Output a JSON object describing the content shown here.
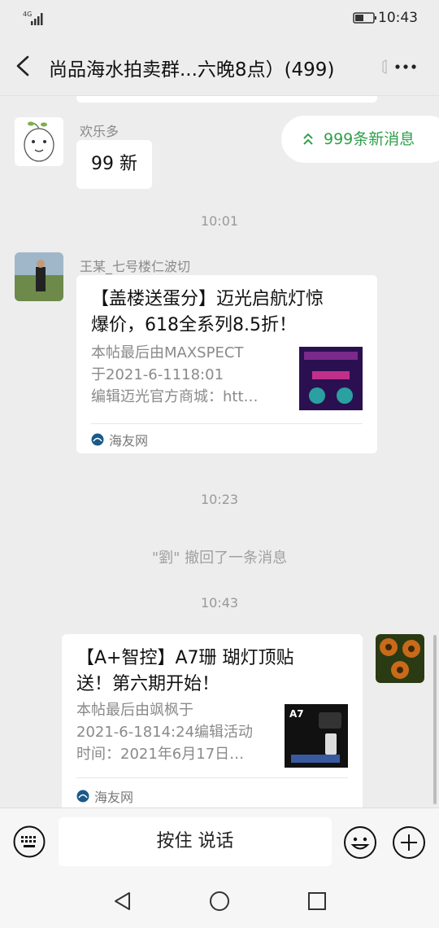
{
  "status_bar": {
    "network": "4G",
    "time": "10:43"
  },
  "header": {
    "title": "尚品海水拍卖群...六晚8点）(499)"
  },
  "new_messages_pill": {
    "label": "999条新消息"
  },
  "messages": [
    {
      "sender": "欢乐多",
      "text": "99 新"
    },
    {
      "time": "10:01"
    },
    {
      "sender": "王某_七号楼仁波切",
      "card": {
        "title": "【盖楼送蛋分】迈光启航灯惊爆价，618全系列8.5折！",
        "desc": "本帖最后由MAXSPECT于2021-6-1118:01编辑迈光官方商城：htt…",
        "source": "海友网"
      }
    },
    {
      "time": "10:23"
    },
    {
      "system": "\"劉\" 撤回了一条消息"
    },
    {
      "time": "10:43"
    },
    {
      "self": true,
      "card": {
        "title": "【A+智控】A7珊 瑚灯顶贴送！第六期开始！",
        "desc": "本帖最后由飒枫于2021-6-1814:24编辑活动时间：2021年6月17日…",
        "source": "海友网",
        "thumb_text": "A7"
      }
    }
  ],
  "display": {
    "m0_sender": "欢乐多",
    "m0_text": "99 新",
    "t1": "10:01",
    "m2_sender": "王某_七号楼仁波切",
    "m2_title_l1": "【盖楼送蛋分】迈光启航灯惊",
    "m2_title_l2": "爆价，618全系列8.5折！",
    "m2_desc_l1": "本帖最后由MAXSPECT",
    "m2_desc_l2": "于2021-6-1118:01",
    "m2_desc_l3": "编辑迈光官方商城：htt…",
    "m2_source": "海友网",
    "t3": "10:23",
    "s4": "\"劉\" 撤回了一条消息",
    "t5": "10:43",
    "m6_title_l1": "【A+智控】A7珊 瑚灯顶贴",
    "m6_title_l2": "送！第六期开始！",
    "m6_desc_l1": "本帖最后由飒枫于",
    "m6_desc_l2": "2021-6-1814:24编辑活动",
    "m6_desc_l3": "时间：2021年6月17日…",
    "m6_source": "海友网",
    "m6_thumb_text": "A7"
  },
  "input_bar": {
    "voice_label": "按住 说话"
  },
  "icons": {
    "back": "chevron-left-icon",
    "more": "more-dots-icon",
    "keyboard": "keyboard-icon",
    "emoji": "emoji-icon",
    "plus": "plus-icon",
    "nav_back": "triangle-back-icon",
    "nav_home": "circle-home-icon",
    "nav_recent": "square-recent-icon"
  },
  "colors": {
    "accent_green": "#2fa04a",
    "chat_bg": "#ededed"
  }
}
